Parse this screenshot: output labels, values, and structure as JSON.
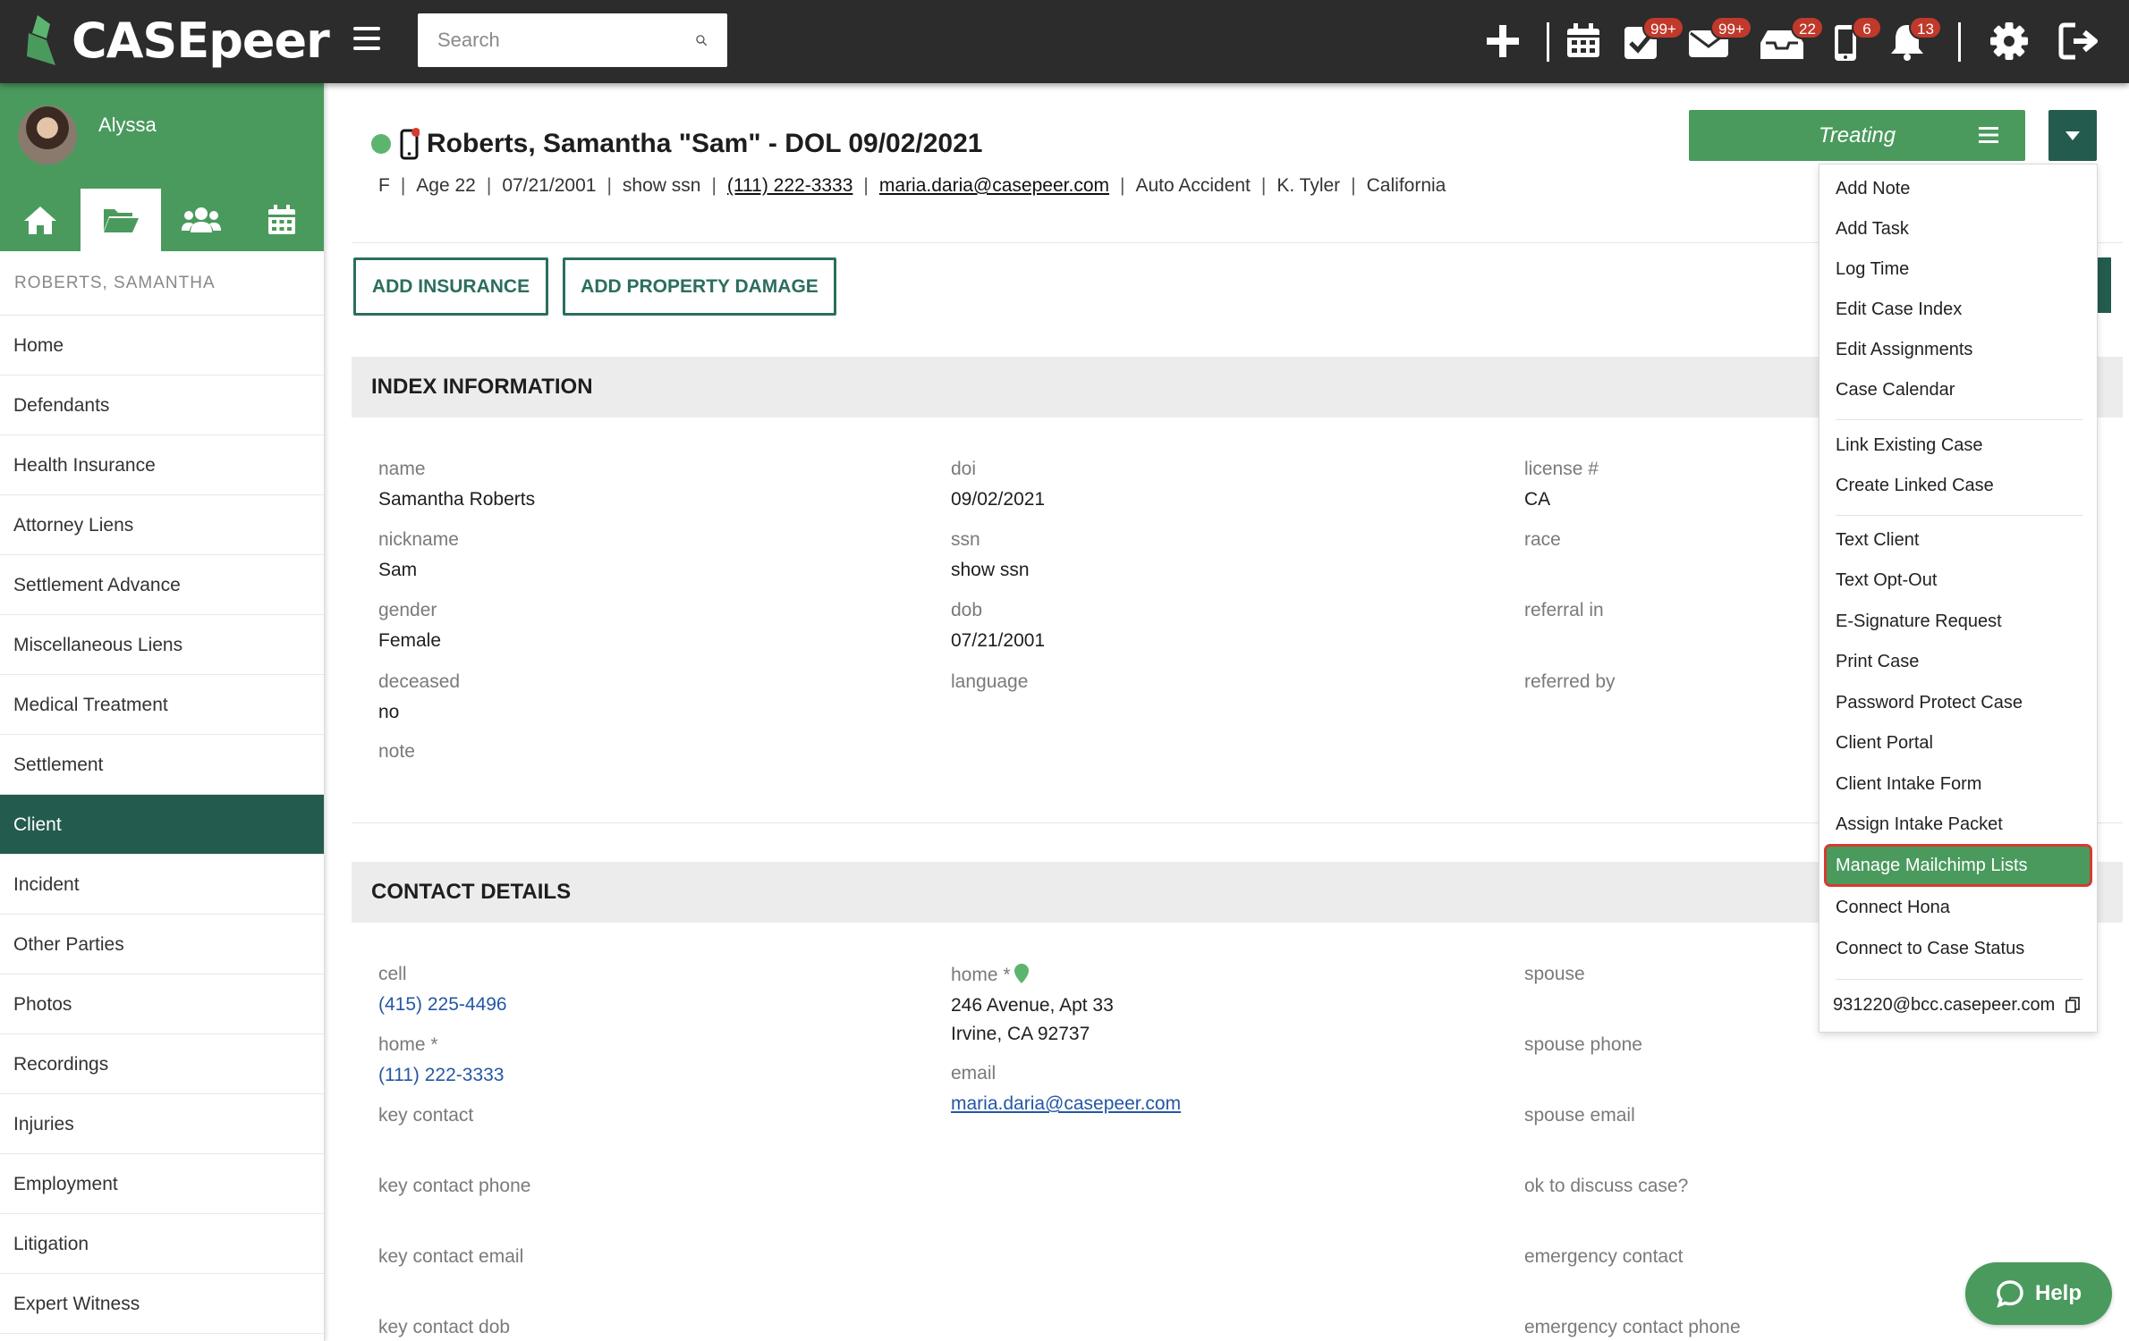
{
  "app": {
    "brand": "CASEpeer",
    "accent": "#4a9a5e",
    "dark_accent": "#235b4e"
  },
  "topbar": {
    "search_placeholder": "Search",
    "icons": [
      {
        "name": "plus-icon"
      },
      {
        "name": "calendar-icon"
      },
      {
        "name": "tasks-icon",
        "badge": "99+"
      },
      {
        "name": "mail-icon",
        "badge": "99+"
      },
      {
        "name": "inbox-icon",
        "badge": "22"
      },
      {
        "name": "mobile-icon",
        "badge": "6"
      },
      {
        "name": "bell-icon",
        "badge": "13"
      },
      {
        "name": "gear-icon"
      },
      {
        "name": "logout-icon"
      }
    ]
  },
  "sidebar": {
    "user_name": "Alyssa",
    "case_label": "ROBERTS, SAMANTHA",
    "items": [
      "Home",
      "Defendants",
      "Health Insurance",
      "Attorney Liens",
      "Settlement Advance",
      "Miscellaneous Liens",
      "Medical Treatment",
      "Settlement",
      "Client",
      "Incident",
      "Other Parties",
      "Photos",
      "Recordings",
      "Injuries",
      "Employment",
      "Litigation",
      "Expert Witness"
    ],
    "active_item": "Client"
  },
  "case": {
    "title": "Roberts, Samantha \"Sam\" - DOL 09/02/2021",
    "sub": [
      "F",
      "Age 22",
      "07/21/2001",
      "show ssn",
      "(111) 222-3333",
      "maria.daria@casepeer.com",
      "Auto Accident",
      "K. Tyler",
      "California"
    ]
  },
  "buttons": {
    "add_insurance": "ADD INSURANCE",
    "add_property_damage": "ADD PROPERTY DAMAGE"
  },
  "status": {
    "label": "Treating"
  },
  "index_info": {
    "title": "INDEX INFORMATION",
    "name_label": "name",
    "name": "Samantha Roberts",
    "nickname_label": "nickname",
    "nickname": "Sam",
    "gender_label": "gender",
    "gender": "Female",
    "deceased_label": "deceased",
    "deceased": "no",
    "note_label": "note",
    "doi_label": "doi",
    "doi": "09/02/2021",
    "ssn_label": "ssn",
    "ssn": "show ssn",
    "dob_label": "dob",
    "dob": "07/21/2001",
    "language_label": "language",
    "license_label": "license #",
    "license": "CA",
    "race_label": "race",
    "referral_in_label": "referral in",
    "referred_by_label": "referred by"
  },
  "contact": {
    "title": "CONTACT DETAILS",
    "cell_label": "cell",
    "cell": "(415) 225-4496",
    "home_label": "home *",
    "home": "(111) 222-3333",
    "key_contact_label": "key contact",
    "key_contact_phone_label": "key contact phone",
    "key_contact_email_label": "key contact email",
    "key_contact_dob_label": "key contact dob",
    "address_label": "home *",
    "address_line1": "246 Avenue, Apt 33",
    "address_line2": "Irvine, CA 92737",
    "email_label": "email",
    "email": "maria.daria@casepeer.com",
    "spouse_label": "spouse",
    "spouse_phone_label": "spouse phone",
    "spouse_email_label": "spouse email",
    "ok_discuss_label": "ok to discuss case?",
    "emergency_contact_label": "emergency contact",
    "emergency_contact_phone_label": "emergency contact phone"
  },
  "dropdown": {
    "add_note": "Add Note",
    "add_task": "Add Task",
    "log_time": "Log Time",
    "edit_case_index": "Edit Case Index",
    "edit_assignments": "Edit Assignments",
    "case_calendar": "Case Calendar",
    "link_existing_case": "Link Existing Case",
    "create_linked_case": "Create Linked Case",
    "text_client": "Text Client",
    "text_opt_out": "Text Opt-Out",
    "esignature_request": "E-Signature Request",
    "print_case": "Print Case",
    "password_protect_case": "Password Protect Case",
    "client_portal": "Client Portal",
    "client_intake_form": "Client Intake Form",
    "assign_intake_packet": "Assign Intake Packet",
    "manage_mailchimp_lists": "Manage Mailchimp Lists",
    "connect_hona": "Connect Hona",
    "connect_case_status": "Connect to Case Status",
    "bcc_email": "931220@bcc.casepeer.com"
  },
  "help": {
    "label": "Help"
  }
}
